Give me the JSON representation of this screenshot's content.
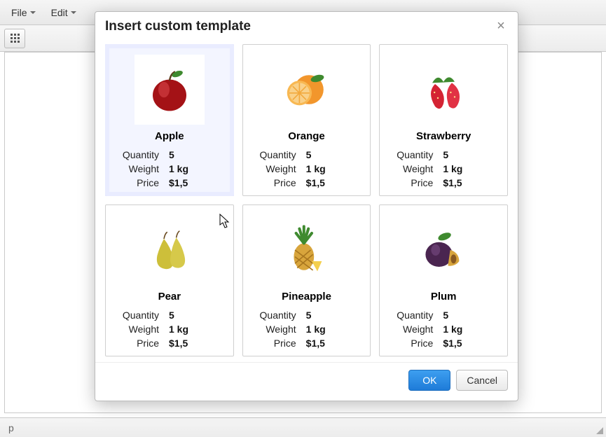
{
  "menubar": {
    "file": "File",
    "edit": "Edit"
  },
  "statusbar": {
    "path": "p"
  },
  "dialog": {
    "title": "Insert custom template",
    "ok": "OK",
    "cancel": "Cancel",
    "labels": {
      "quantity": "Quantity",
      "weight": "Weight",
      "price": "Price"
    },
    "items": [
      {
        "name": "Apple",
        "icon": "apple-icon",
        "quantity": "5",
        "weight": "1 kg",
        "price": "$1,5",
        "selected": true
      },
      {
        "name": "Orange",
        "icon": "orange-icon",
        "quantity": "5",
        "weight": "1 kg",
        "price": "$1,5",
        "selected": false
      },
      {
        "name": "Strawberry",
        "icon": "strawberry-icon",
        "quantity": "5",
        "weight": "1 kg",
        "price": "$1,5",
        "selected": false
      },
      {
        "name": "Pear",
        "icon": "pear-icon",
        "quantity": "5",
        "weight": "1 kg",
        "price": "$1,5",
        "selected": false
      },
      {
        "name": "Pineapple",
        "icon": "pineapple-icon",
        "quantity": "5",
        "weight": "1 kg",
        "price": "$1,5",
        "selected": false
      },
      {
        "name": "Plum",
        "icon": "plum-icon",
        "quantity": "5",
        "weight": "1 kg",
        "price": "$1,5",
        "selected": false
      }
    ]
  }
}
